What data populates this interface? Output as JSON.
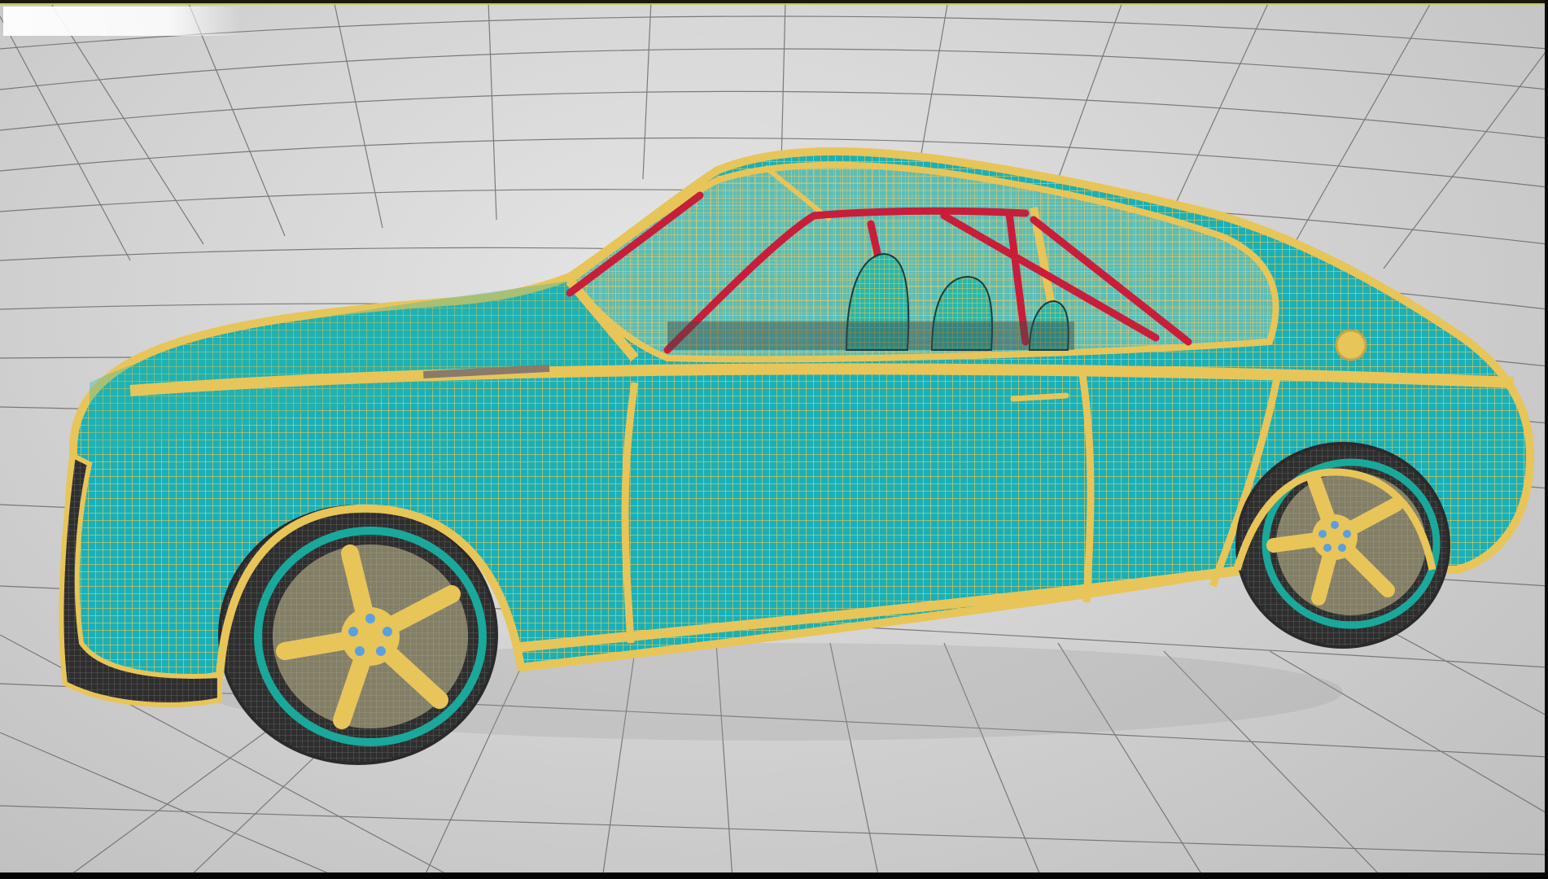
{
  "app": {
    "viewport_label": "",
    "render_mode": "wireframe"
  },
  "colors": {
    "background": "#d0d0d0",
    "grid_line": "#6a6a6a",
    "body_fill": "#1ab0b8",
    "body_wire": "#e8c558",
    "rollcage": "#c81e3a",
    "tire": "#3a3a3a",
    "rim_ring": "#1aa89a",
    "hub_bolt": "#5aa0e0"
  },
  "icons": {
    "viewport_label": "viewport-label-icon"
  }
}
